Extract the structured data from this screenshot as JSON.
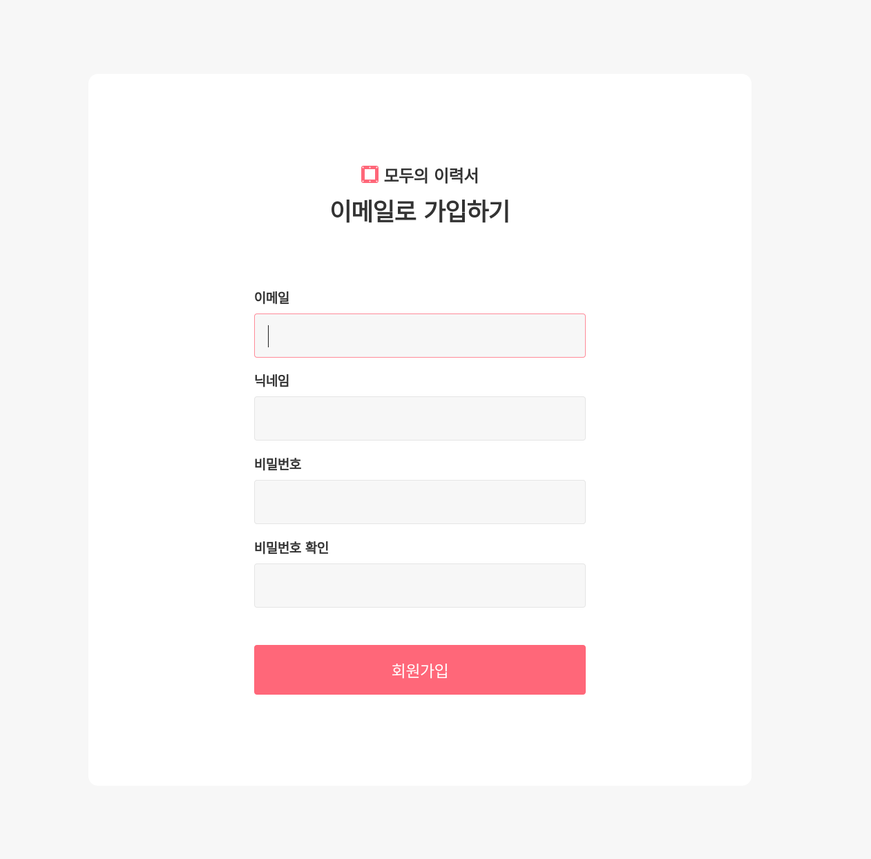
{
  "brand": {
    "name": "모두의 이력서",
    "icon": "film-frame-icon",
    "color": "#ff6779"
  },
  "page": {
    "title": "이메일로 가입하기"
  },
  "form": {
    "fields": [
      {
        "label": "이메일",
        "value": "",
        "focused": true
      },
      {
        "label": "닉네임",
        "value": ""
      },
      {
        "label": "비밀번호",
        "value": ""
      },
      {
        "label": "비밀번호 확인",
        "value": ""
      }
    ],
    "submit_label": "회원가입"
  },
  "colors": {
    "accent": "#ff6779",
    "focus_border": "#ff8b99",
    "background": "#f7f7f7",
    "card": "#ffffff",
    "text": "#333333"
  }
}
